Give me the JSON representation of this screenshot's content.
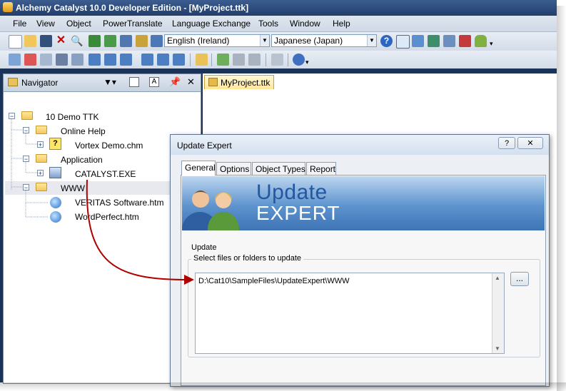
{
  "window": {
    "title": "Alchemy Catalyst 10.0 Developer Edition - [MyProject.ttk]"
  },
  "menu": [
    "File",
    "View",
    "Object",
    "PowerTranslate",
    "Language Exchange",
    "Tools",
    "Window",
    "Help"
  ],
  "toolbar": {
    "source_language": "English (Ireland)",
    "target_language": "Japanese (Japan)"
  },
  "navigator": {
    "title": "Navigator",
    "tree": [
      {
        "label": "10 Demo TTK"
      },
      {
        "label": "Online Help"
      },
      {
        "label": "Vortex Demo.chm"
      },
      {
        "label": "Application"
      },
      {
        "label": "CATALYST.EXE"
      },
      {
        "label": "WWW"
      },
      {
        "label": "VERITAS Software.htm"
      },
      {
        "label": "WordPerfect.htm"
      }
    ]
  },
  "document_tab": {
    "label": "MyProject.ttk"
  },
  "dialog": {
    "title": "Update Expert",
    "help_btn": "?",
    "close_btn": "✕",
    "tabs": [
      "General",
      "Options",
      "Object Types",
      "Report"
    ],
    "banner_line1": "Update",
    "banner_line2": "EXPERT",
    "section_title": "Update",
    "group_label": "Select files or folders to update",
    "file_entry": "D:\\Cat10\\SampleFiles\\UpdateExpert\\WWW",
    "browse_label": "..."
  },
  "colors": {
    "titlebar": "#223e6d",
    "workspace": "#1c3358",
    "arrow": "#b00000",
    "banner": "#5d93cd"
  }
}
